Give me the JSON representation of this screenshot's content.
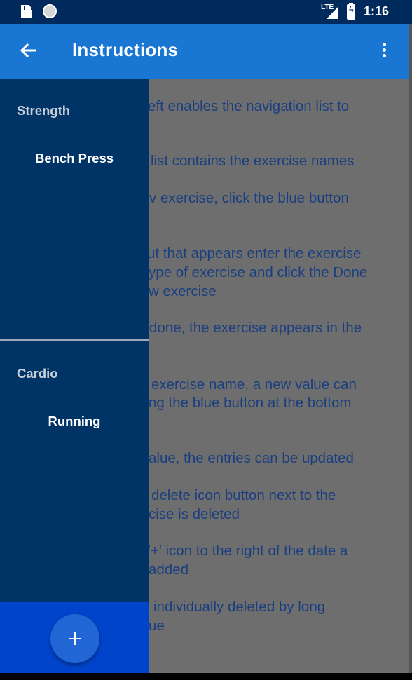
{
  "status_bar": {
    "network": "LTE",
    "time": "1:16"
  },
  "app_bar": {
    "title": "Instructions",
    "icons": [
      "back-arrow-icon",
      "more-vert-icon"
    ]
  },
  "content": {
    "lines": [
      "eft enables the navigation list to",
      "list contains the exercise names",
      "v exercise, click the blue button",
      "ut that appears enter the exercise",
      "ype of exercise and click the Done",
      "w exercise",
      "done, the exercise appears in the",
      "exercise name, a new value can",
      "ng the blue button at the bottom",
      "alue, the entries can be updated",
      "delete icon button next to the",
      "cise is deleted",
      "'+' icon to the right of the date a",
      "added",
      "individually deleted by long",
      "ue"
    ]
  },
  "drawer": {
    "sections": [
      {
        "title": "Strength",
        "items": [
          "Bench Press"
        ]
      },
      {
        "title": "Cardio",
        "items": [
          "Running"
        ]
      }
    ],
    "fab_icon": "plus-icon"
  },
  "colors": {
    "status_bar": "#002a5c",
    "app_bar": "#1976d2",
    "drawer": "#003366",
    "drawer_footer": "#0044cc",
    "fab": "#2166d4"
  }
}
